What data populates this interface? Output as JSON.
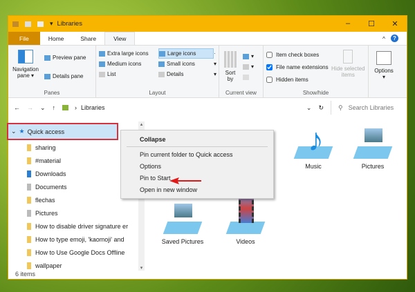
{
  "window": {
    "title": "Libraries",
    "min": "–",
    "max": "☐",
    "close": "✕"
  },
  "tabs": [
    "File",
    "Home",
    "Share",
    "View"
  ],
  "ribbon": {
    "panes": {
      "nav": "Navigation pane",
      "preview": "Preview pane",
      "details": "Details pane",
      "label": "Panes"
    },
    "layout": {
      "items": [
        "Extra large icons",
        "Large icons",
        "Medium icons",
        "Small icons",
        "List",
        "Details"
      ],
      "selected": "Large icons",
      "label": "Layout"
    },
    "current_view": {
      "sort": "Sort by",
      "label": "Current view"
    },
    "show_hide": {
      "item_check_boxes": "Item check boxes",
      "file_name_extensions": "File name extensions",
      "hidden_items": "Hidden items",
      "hide_selected": "Hide selected items",
      "label": "Show/hide",
      "checked": {
        "item_check_boxes": false,
        "file_name_extensions": true,
        "hidden_items": false
      }
    },
    "options": "Options"
  },
  "address": {
    "path": "Libraries",
    "search_placeholder": "Search Libraries"
  },
  "nav": {
    "quick_access": "Quick access",
    "items": [
      "sharing",
      "#material",
      "Downloads",
      "Documents",
      "flechas",
      "Pictures",
      "How to disable driver signature er",
      "How to type emoji, 'kaomoji' and",
      "How to Use Google Docs Offline",
      "wallpaper"
    ]
  },
  "context_menu": {
    "header": "Collapse",
    "items": [
      "Pin current folder to Quick access",
      "Options",
      "Pin to Start",
      "Open in new window"
    ]
  },
  "libraries": [
    "Music",
    "Pictures",
    "Saved Pictures",
    "Videos"
  ],
  "status": "6 items",
  "colors": {
    "titlebar": "#f7b500",
    "file_tab": "#d28b00",
    "highlight": "#d8303d",
    "selection": "#cce4f7"
  }
}
